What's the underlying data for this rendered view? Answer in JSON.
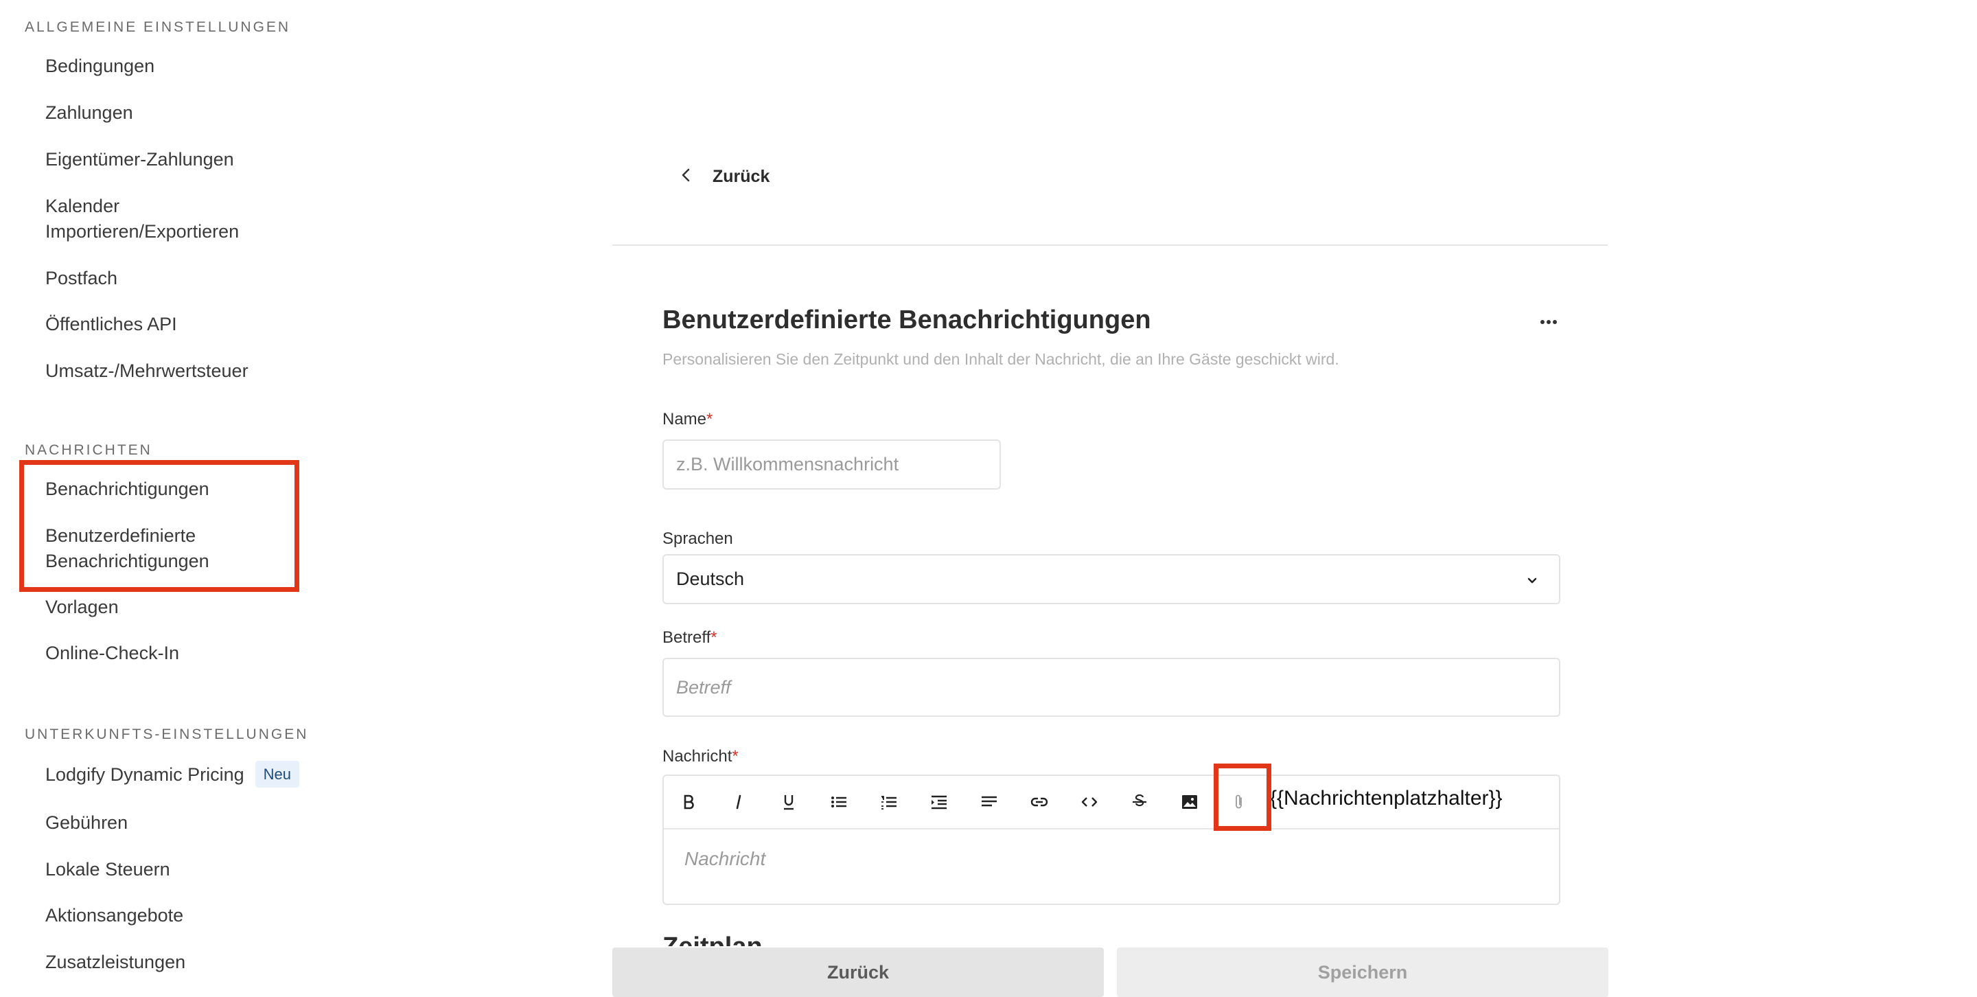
{
  "sidebar": {
    "section_general": "ALLGEMEINE EINSTELLUNGEN",
    "general_items": [
      "Bedingungen",
      "Zahlungen",
      "Eigentümer-Zahlungen",
      "Kalender",
      "Importieren/Exportieren",
      "Postfach",
      "Öffentliches API",
      "Umsatz-/Mehrwertsteuer"
    ],
    "section_messages": "NACHRICHTEN",
    "message_items": [
      "Benachrichtigungen",
      "Benutzerdefinierte",
      "Benachrichtigungen",
      "Vorlagen",
      "Online-Check-In"
    ],
    "section_property": "UNTERKUNFTS-EINSTELLUNGEN",
    "property_items": [
      "Lodgify Dynamic Pricing",
      "Gebühren",
      "Lokale Steuern",
      "Aktionsangebote",
      "Zusatzleistungen"
    ],
    "badge_new": "Neu"
  },
  "main": {
    "back_link": "Zurück",
    "title": "Benutzerdefinierte Benachrichtigungen",
    "subtitle": "Personalisieren Sie den Zeitpunkt und den Inhalt der Nachricht, die an Ihre Gäste geschickt wird.",
    "more_label": "···",
    "name_label": "Name",
    "name_placeholder": "z.B. Willkommensnachricht",
    "languages_label": "Sprachen",
    "language_value": "Deutsch",
    "subject_label": "Betreff",
    "subject_placeholder": "Betreff",
    "message_label": "Nachricht",
    "message_placeholder": "Nachricht",
    "placeholder_token": "{{Nachrichtenplatzhalter}}",
    "required_marker": "*",
    "schedule_heading": "Zeitplan"
  },
  "footer": {
    "back_button": "Zurück",
    "save_button": "Speichern"
  },
  "colors": {
    "highlight": "#e23618",
    "required": "#d0342c",
    "badge_bg": "#e8f1fb"
  },
  "toolbar_icons": [
    "bold-icon",
    "italic-icon",
    "underline-icon",
    "bulleted-list-icon",
    "numbered-list-icon",
    "indent-icon",
    "align-left-icon",
    "link-icon",
    "code-icon",
    "strikethrough-icon",
    "image-icon",
    "attachment-icon"
  ]
}
